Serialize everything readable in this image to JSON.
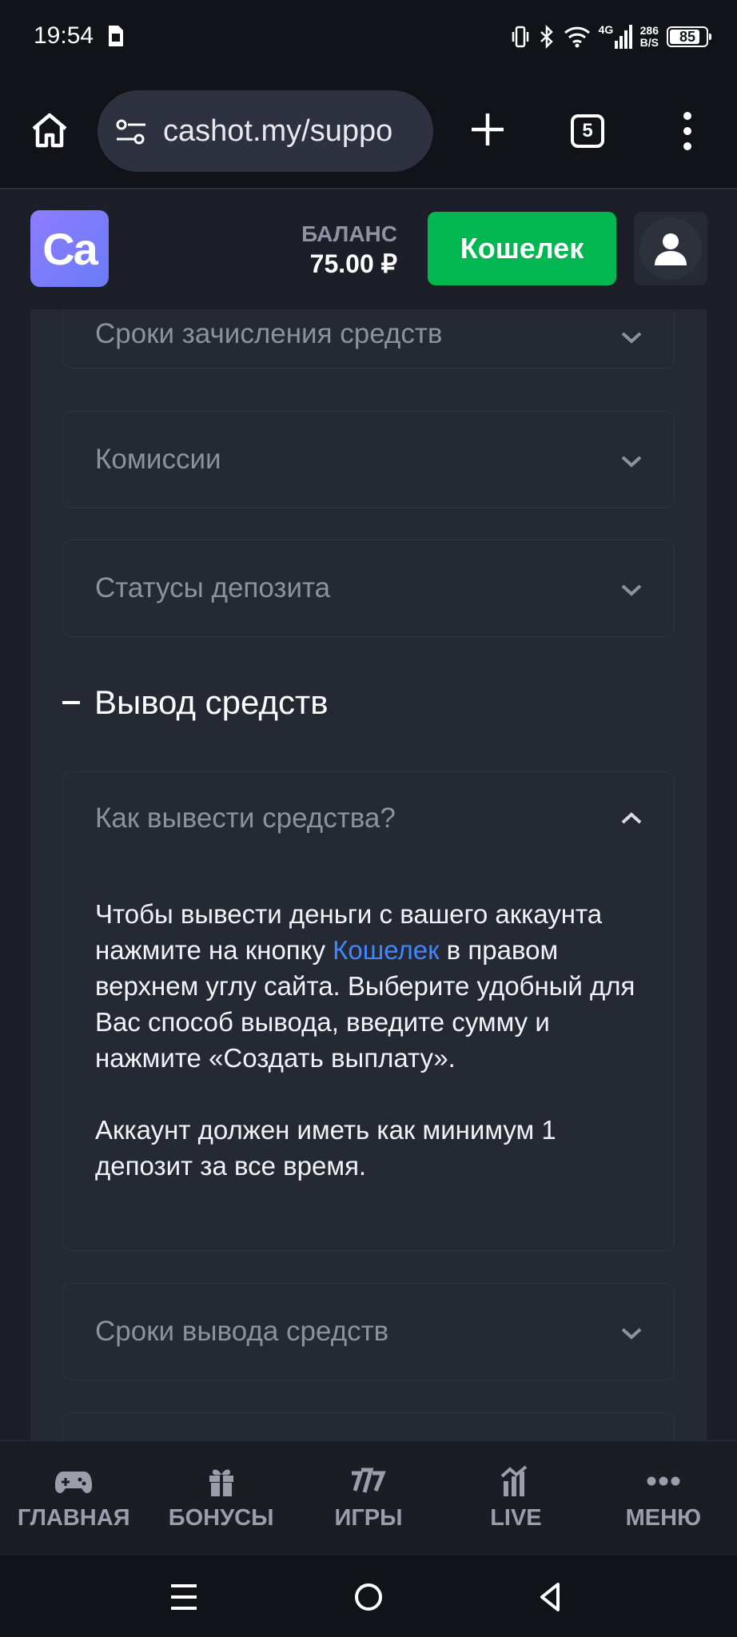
{
  "status_bar": {
    "time": "19:54",
    "net_speed_value": "286",
    "net_speed_unit": "B/S",
    "network": "4G",
    "battery": "85"
  },
  "browser": {
    "url": "cashot.my/suppo",
    "tab_count": "5"
  },
  "site_header": {
    "logo_text": "Ca",
    "balance_label": "БАЛАНС",
    "balance_value": "75.00 ₽",
    "wallet_button": "Кошелек",
    "brand_color": "#02b651"
  },
  "faq": {
    "deposit_items": [
      {
        "title": "Сроки зачисления средств"
      },
      {
        "title": "Комиссии"
      },
      {
        "title": "Статусы депозита"
      }
    ],
    "section_title": "Вывод средств",
    "open_item": {
      "title": "Как вывести средства?",
      "body_before_link": "Чтобы вывести деньги с вашего аккаунта нажмите на кнопку ",
      "body_link": "Кошелек",
      "body_after_link": " в правом верхнем углу сайта. Выберите удобный для Вас способ вывода, введите сумму и нажмите «Создать выплату».",
      "body_second": "Аккаунт должен иметь как минимум 1 депозит за все время."
    },
    "withdraw_items": [
      {
        "title": "Сроки вывода средств"
      }
    ]
  },
  "bottom_nav": {
    "items": [
      {
        "label": "ГЛАВНАЯ",
        "icon": "gamepad-icon"
      },
      {
        "label": "БОНУСЫ",
        "icon": "gift-icon"
      },
      {
        "label": "ИГРЫ",
        "icon": "slots-777-icon"
      },
      {
        "label": "LIVE",
        "icon": "live-chart-icon"
      },
      {
        "label": "МЕНЮ",
        "icon": "more-dots-icon"
      }
    ]
  }
}
